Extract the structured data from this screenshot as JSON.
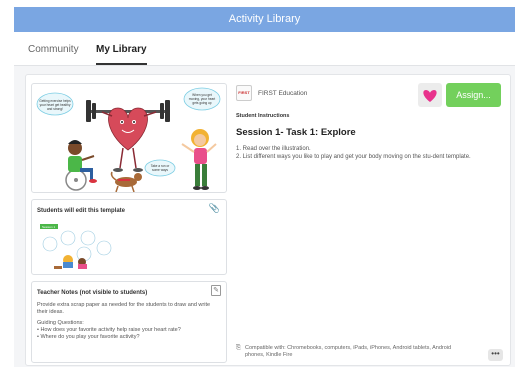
{
  "window": {
    "title": "Activity Library"
  },
  "tabs": [
    {
      "label": "Community",
      "active": false
    },
    {
      "label": "My Library",
      "active": true
    }
  ],
  "activity": {
    "publisher": "FIRST Education",
    "publisher_logo_text": "FIRST",
    "instructions_label": "Student Instructions",
    "title": "Session 1- Task 1: Explore",
    "steps": [
      "1. Read over the illustration.",
      "2. List different ways you like to play and get your body moving on the stu-dent template."
    ],
    "compatibility": "Compatible with: Chromebooks, computers, iPads, iPhones, Android tablets, Android phones, Kindle Fire",
    "assign_label": "Assign...",
    "more_label": "•••"
  },
  "illustration": {
    "bubbles": [
      "Getting exercise helps your heart get healthy and strong!",
      "When you get moving, your heart gets going up",
      "Take a run or some ways"
    ]
  },
  "template_panel": {
    "title": "Students will edit this template",
    "thumbnail_badge": "Session 1"
  },
  "teacher_notes": {
    "title": "Teacher Notes (not visible to students)",
    "intro": "Provide extra scrap paper as needed for the students to draw and write their ideas.",
    "guiding_label": "Guiding Questions:",
    "questions": [
      "• How does your favorite activity help raise your heart rate?",
      "• Where do you play your favorite activity?"
    ]
  },
  "colors": {
    "titlebar": "#7aa6e2",
    "assign": "#73d05c",
    "heart_favorite": "#e8328c",
    "heart_character": "#d64a5a"
  }
}
